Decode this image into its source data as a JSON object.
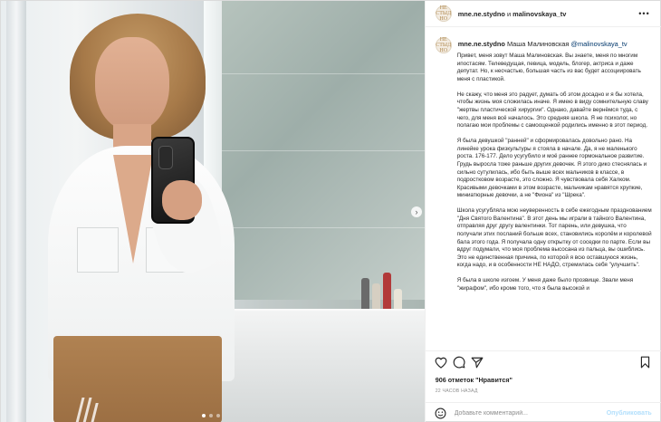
{
  "header": {
    "author": "mne.ne.stydno",
    "conjunction": "и",
    "coauthor": "malinovskaya_tv",
    "avatar_text": "НЕ СТЫД\nНО",
    "more_icon": "more-horizontal-icon"
  },
  "caption": {
    "username": "mne.ne.stydno",
    "name": "Маша Малиновская",
    "mention": "@malinovskaya_tv",
    "paragraphs": [
      "Привет, меня зовут Маша Малиновская. Вы знаете, меня по многим ипостасям. Телеведущая, певица, модель, блогер, актриса и даже депутат. Но, к несчастью, большая часть из вас будет ассоциировать меня с пластикой.",
      "Не скажу, что меня это радует, думать об этом досадно и я бы хотела, чтобы жизнь моя сложилась иначе. Я имею в виду сомнительную славу \"жертвы пластической хирургии\". Однако, давайте вернёмся туда, с чего, для меня всё началось. Это средняя школа. Я не психолог, но полагаю мои проблемы с самооценкой родились именно в этот период.",
      "Я была девушкой \"ранней\" и сформировалась довольно рано. На линейке урока физкультуры я стояла в начале. Да, я не маленького роста. 176-177. Дело усугубило и моё раннее гормональное развитие. Грудь выросла тоже раньше других девочек. Я этого дико стеснялась и сильно сутулилась, ибо быть выше всех мальчиков в классе, в подростковом возрасте, это сложно. Я чувствовала себя Халком. Красивыми девочками в этом возрасте, мальчикам нравятся хрупкие, миниатюрные девочки, а не \"Фиона\" из \"Шрека\".",
      "Школа усугубляла мою неуверенность в себе ежегодным празднованием \"Дня Святого Валентина\". В этот день мы играли в тайного Валентина, отправляя друг другу валентинки. Тот парень, или девушка, что получали этих посланий больше всех, становились королём и королевой бала этого года. Я получала одну открытку от соседки по парте. Если вы вдруг подумали, что моя проблема высосана из пальца, вы ошиблись. Это не единственная причина, по которой я всю оставшуюся жизнь, когда надо, и в особенности НЕ НАДО, стремилась себя \"улучшить\".",
      "Я была в школе изгоем. У меня даже было прозвище. Звали меня \"жирафом\", ибо кроме того, что я была высокой и"
    ]
  },
  "actions": {
    "like_icon": "heart-icon",
    "comment_icon": "comment-icon",
    "share_icon": "send-icon",
    "save_icon": "bookmark-icon",
    "likes_text": "906 отметок \"Нравится\"",
    "time_text": "22 часов назад",
    "emoji_icon": "smiley-icon",
    "comment_placeholder": "Добавьте комментарий...",
    "publish_label": "Опубликовать"
  },
  "media": {
    "carousel_dots": 3,
    "active_dot": 1,
    "next_icon": "chevron-right-icon"
  },
  "colors": {
    "accent_blue": "#0095f6",
    "publish_disabled": "#b2dffc",
    "mention": "#00376b",
    "secondary_text": "#8e8e8e"
  }
}
